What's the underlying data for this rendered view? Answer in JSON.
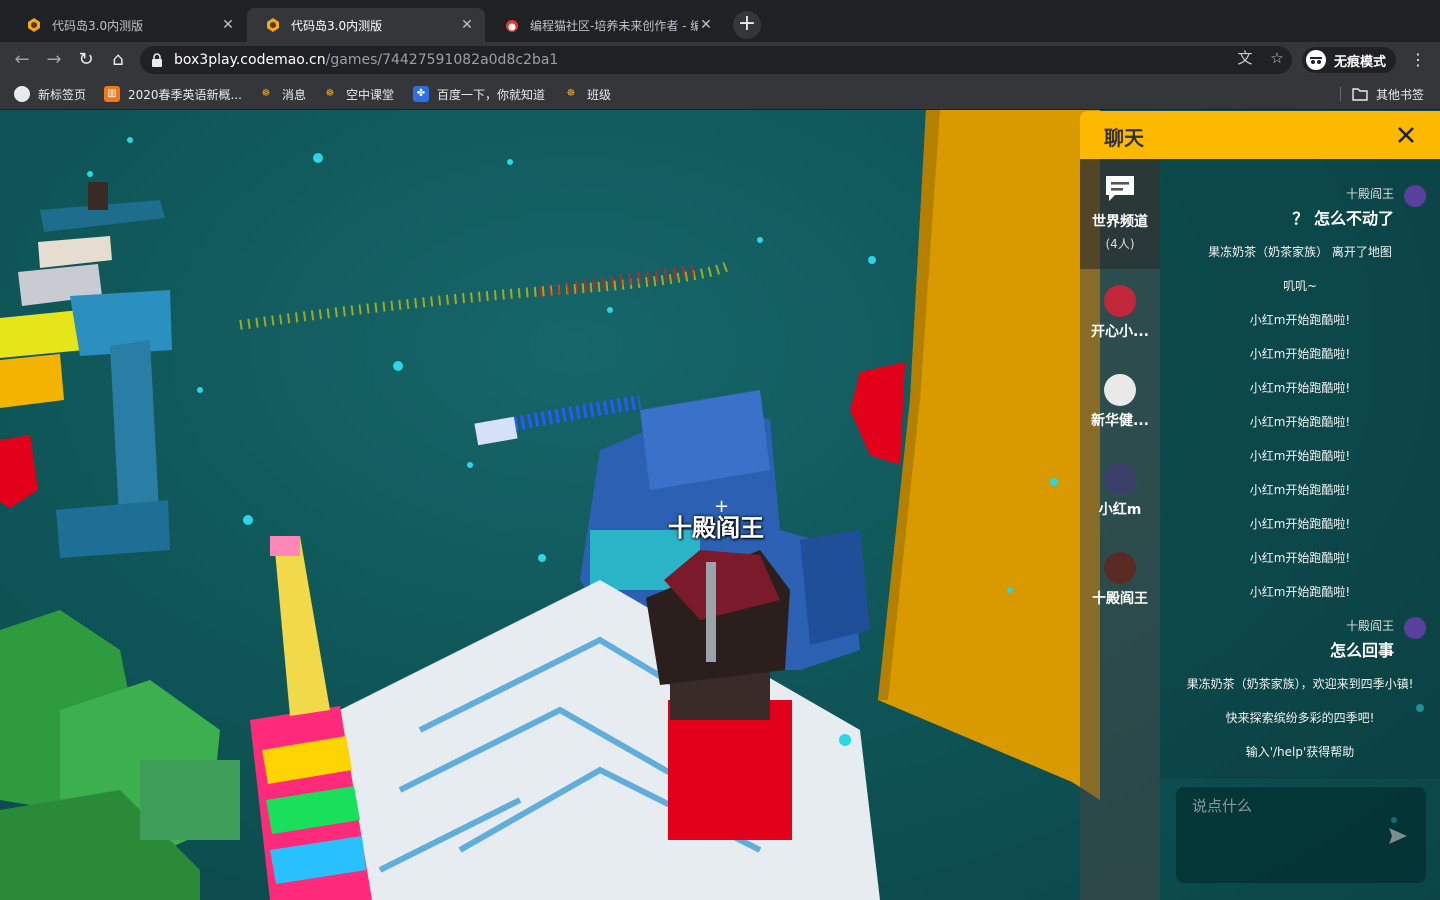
{
  "browser": {
    "tabs": [
      {
        "title": "代码岛3.0内测版",
        "active": false
      },
      {
        "title": "代码岛3.0内测版",
        "active": true
      },
      {
        "title": "编程猫社区-培养未来创作者 - 编",
        "active": false
      }
    ],
    "url": {
      "host": "box3play.codemao.cn",
      "path": "/games/74427591082a0d8c2ba1"
    },
    "incognito_label": "无痕模式",
    "bookmarks": [
      {
        "label": "新标签页",
        "icon": "globe-icon"
      },
      {
        "label": "2020春季英语新概...",
        "icon": "orange-bookmark-icon"
      },
      {
        "label": "消息",
        "icon": "codemao-icon"
      },
      {
        "label": "空中课堂",
        "icon": "codemao-icon"
      },
      {
        "label": "百度一下，你就知道",
        "icon": "baidu-icon"
      },
      {
        "label": "班级",
        "icon": "codemao-icon"
      }
    ],
    "other_bookmarks": "其他书签"
  },
  "game": {
    "nametag": "十殿阎王",
    "colors": {
      "sky": "#0f5658",
      "orange_wall": "#e0a000",
      "red_block": "#e3001b"
    }
  },
  "chat": {
    "title": "聊天",
    "world_channel": {
      "label": "世界频道",
      "count": "(4人)"
    },
    "players": [
      {
        "name": "开心小..."
      },
      {
        "name": "新华健..."
      },
      {
        "name": "小红m"
      },
      {
        "name": "十殿阎王"
      }
    ],
    "messages": [
      {
        "kind": "user",
        "user": "十殿阎王",
        "text": "？ 怎么不动了"
      },
      {
        "kind": "system",
        "text": "果冻奶茶（奶茶家族） 离开了地图"
      },
      {
        "kind": "system",
        "text": "叽叽~"
      },
      {
        "kind": "system",
        "text": "小红m开始跑酷啦!"
      },
      {
        "kind": "system",
        "text": "小红m开始跑酷啦!"
      },
      {
        "kind": "system",
        "text": "小红m开始跑酷啦!"
      },
      {
        "kind": "system",
        "text": "小红m开始跑酷啦!"
      },
      {
        "kind": "system",
        "text": "小红m开始跑酷啦!"
      },
      {
        "kind": "system",
        "text": "小红m开始跑酷啦!"
      },
      {
        "kind": "system",
        "text": "小红m开始跑酷啦!"
      },
      {
        "kind": "system",
        "text": "小红m开始跑酷啦!"
      },
      {
        "kind": "system",
        "text": "小红m开始跑酷啦!"
      },
      {
        "kind": "user",
        "user": "十殿阎王",
        "text": "怎么回事"
      },
      {
        "kind": "system",
        "text": "果冻奶茶（奶茶家族），欢迎来到四季小镇!"
      },
      {
        "kind": "system",
        "text": "快来探索缤纷多彩的四季吧!"
      },
      {
        "kind": "system",
        "text": "输入'/help'获得帮助"
      }
    ],
    "input_placeholder": "说点什么"
  }
}
